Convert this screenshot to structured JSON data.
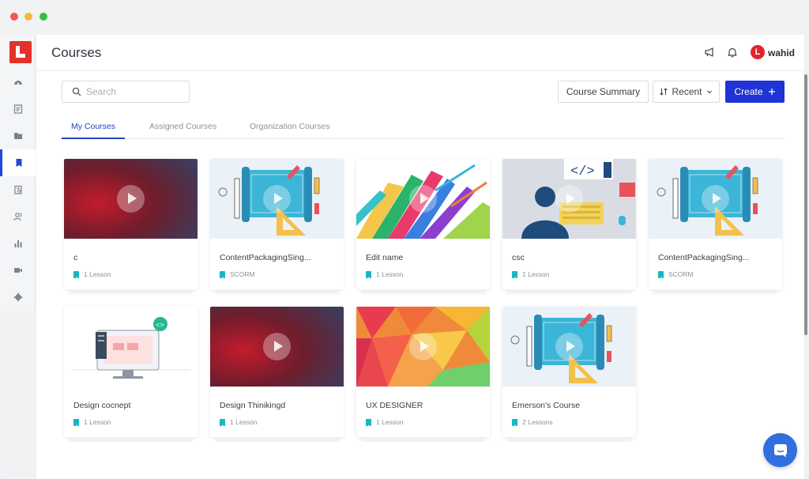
{
  "header": {
    "title": "Courses",
    "user": {
      "initial": "L",
      "name": "wahid"
    }
  },
  "sidebar": {
    "items": [
      {
        "name": "dashboard",
        "icon": "gauge-icon"
      },
      {
        "name": "list",
        "icon": "document-list-icon"
      },
      {
        "name": "folder",
        "icon": "folder-icon"
      },
      {
        "name": "courses",
        "icon": "book-icon",
        "active": true
      },
      {
        "name": "reports",
        "icon": "clipboard-icon"
      },
      {
        "name": "users",
        "icon": "users-icon"
      },
      {
        "name": "analytics",
        "icon": "bar-chart-icon"
      },
      {
        "name": "video",
        "icon": "video-camera-icon"
      },
      {
        "name": "settings",
        "icon": "gear-icon"
      }
    ]
  },
  "toolbar": {
    "search_placeholder": "Search",
    "summary_label": "Course Summary",
    "recent_label": "Recent",
    "create_label": "Create"
  },
  "tabs": [
    {
      "label": "My Courses",
      "active": true
    },
    {
      "label": "Assigned Courses",
      "active": false
    },
    {
      "label": "Organization Courses",
      "active": false
    }
  ],
  "courses": [
    {
      "title": "c",
      "meta": "1 Lesson",
      "thumb": "red-gradient"
    },
    {
      "title": "ContentPackagingSing...",
      "meta": "SCORM",
      "thumb": "blueprint"
    },
    {
      "title": "Edit name",
      "meta": "1 Lesson",
      "thumb": "arrows"
    },
    {
      "title": "csc",
      "meta": "1 Lesson",
      "thumb": "coder"
    },
    {
      "title": "ContentPackagingSing...",
      "meta": "SCORM",
      "thumb": "blueprint"
    },
    {
      "title": "Design cocnept",
      "meta": "1 Lesson",
      "thumb": "monitor"
    },
    {
      "title": "Design Thinikingd",
      "meta": "1 Lesson",
      "thumb": "red-gradient"
    },
    {
      "title": "UX DESIGNER",
      "meta": "1 Lesson",
      "thumb": "polygon"
    },
    {
      "title": "Emerson's Course",
      "meta": "2 Lessons",
      "thumb": "blueprint"
    }
  ],
  "colors": {
    "accent": "#1f33d6",
    "logo": "#e5312b",
    "lesson_icon": "#17b6c2",
    "chat": "#2f6fe0"
  }
}
